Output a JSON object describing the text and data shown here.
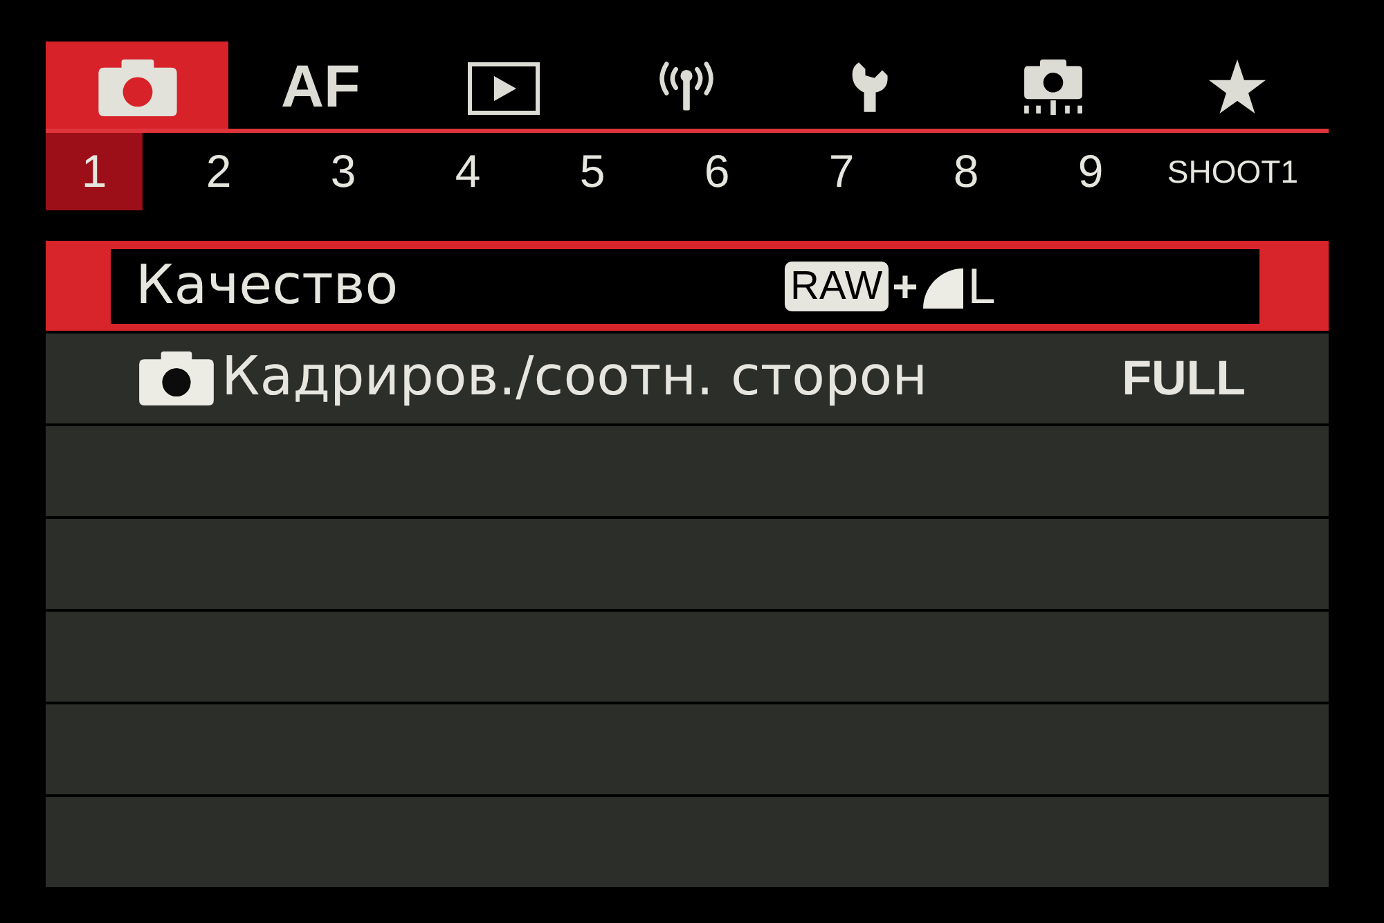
{
  "tabs": [
    {
      "kind": "shoot",
      "selected": true
    },
    {
      "kind": "af",
      "label": "AF",
      "selected": false
    },
    {
      "kind": "play",
      "selected": false
    },
    {
      "kind": "wireless",
      "selected": false
    },
    {
      "kind": "setup",
      "selected": false
    },
    {
      "kind": "custom",
      "selected": false
    },
    {
      "kind": "mymenu",
      "selected": false
    }
  ],
  "pages": [
    {
      "label": "1",
      "selected": true
    },
    {
      "label": "2",
      "selected": false
    },
    {
      "label": "3",
      "selected": false
    },
    {
      "label": "4",
      "selected": false
    },
    {
      "label": "5",
      "selected": false
    },
    {
      "label": "6",
      "selected": false
    },
    {
      "label": "7",
      "selected": false
    },
    {
      "label": "8",
      "selected": false
    },
    {
      "label": "9",
      "selected": false
    }
  ],
  "page_title": "SHOOT1",
  "menu": {
    "items": [
      {
        "kind": "quality",
        "label": "Качество",
        "selected": true,
        "camera_icon": false,
        "badge": "RAW",
        "joiner": "+",
        "size": "L"
      },
      {
        "kind": "text",
        "label": "Кадриров./соотн. сторон",
        "selected": false,
        "camera_icon": true,
        "value": "FULL"
      }
    ]
  }
}
